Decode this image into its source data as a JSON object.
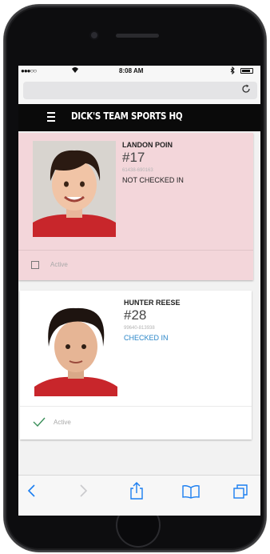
{
  "status_bar": {
    "carrier": "●●●○○",
    "time": "8:08 AM"
  },
  "browser": {
    "reload_icon": "reload-icon"
  },
  "nav": {
    "brand": "DICK'S TEAM SPORTS HQ"
  },
  "players": [
    {
      "name": "LANDON POIN",
      "number": "#17",
      "id": "61438-690163",
      "status": "NOT CHECKED IN",
      "active_label": "Active",
      "active": false
    },
    {
      "name": "HUNTER REESE",
      "number": "#28",
      "id": "99640-813938",
      "status": "CHECKED IN",
      "active_label": "Active",
      "active": true
    }
  ],
  "colors": {
    "not_checked_bg": "#f3d6da",
    "checked_text": "#2a86c8",
    "check_green": "#3a8f5a",
    "ios_blue": "#1a7ef1"
  }
}
